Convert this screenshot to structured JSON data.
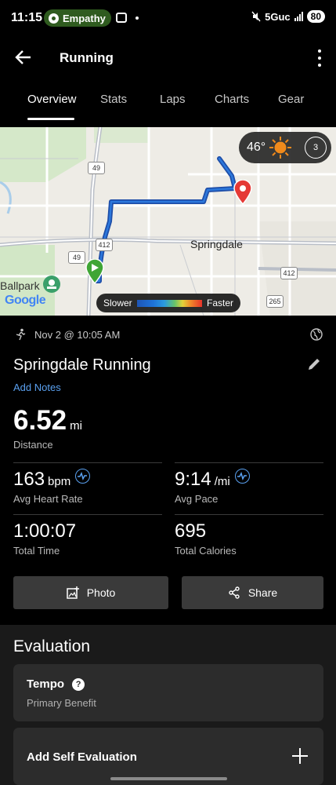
{
  "status_bar": {
    "time": "11:15",
    "notification_app": "Empathy",
    "network": "5Guc",
    "battery": "80"
  },
  "app_bar": {
    "title": "Running"
  },
  "tabs": [
    {
      "label": "Overview",
      "active": true
    },
    {
      "label": "Stats",
      "active": false
    },
    {
      "label": "Laps",
      "active": false
    },
    {
      "label": "Charts",
      "active": false
    },
    {
      "label": "Gear",
      "active": false
    }
  ],
  "map": {
    "weather_temp": "46°",
    "wind_speed": "3",
    "city_label": "Springdale",
    "park_label": "Ballpark",
    "attribution": "Google",
    "route_shields": [
      "49",
      "412",
      "49",
      "412",
      "265"
    ],
    "legend": {
      "slow_label": "Slower",
      "fast_label": "Faster"
    },
    "colors": {
      "route": "#1e5bbf",
      "end_pin": "#e53935",
      "start_pin": "#3fa535"
    }
  },
  "activity": {
    "date": "Nov 2 @ 10:05 AM",
    "title": "Springdale Running",
    "add_notes": "Add Notes"
  },
  "stats": {
    "distance": {
      "value": "6.52",
      "unit": "mi",
      "label": "Distance"
    },
    "heart_rate": {
      "value": "163",
      "unit": "bpm",
      "label": "Avg Heart Rate"
    },
    "pace": {
      "value": "9:14",
      "unit": "/mi",
      "label": "Avg Pace"
    },
    "time": {
      "value": "1:00:07",
      "label": "Total Time"
    },
    "calories": {
      "value": "695",
      "label": "Total Calories"
    }
  },
  "actions": {
    "photo": "Photo",
    "share": "Share"
  },
  "evaluation": {
    "title": "Evaluation",
    "benefit_name": "Tempo",
    "benefit_sub": "Primary Benefit",
    "self_eval": "Add Self Evaluation"
  }
}
